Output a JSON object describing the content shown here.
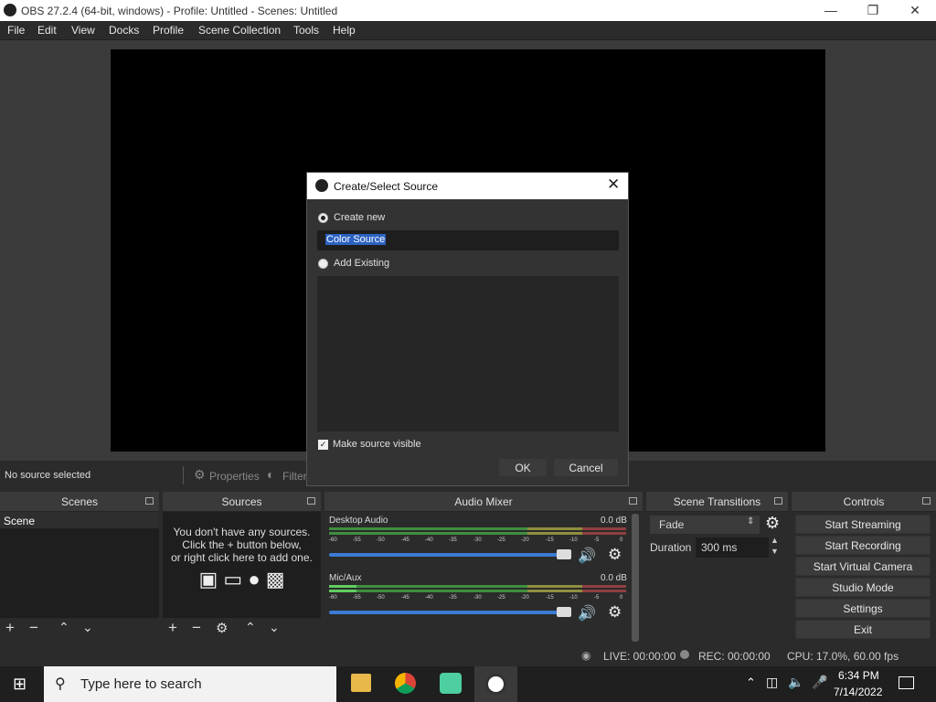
{
  "window": {
    "title": "OBS 27.2.4 (64-bit, windows) - Profile: Untitled - Scenes: Untitled"
  },
  "menu": [
    "File",
    "Edit",
    "View",
    "Docks",
    "Profile",
    "Scene Collection",
    "Tools",
    "Help"
  ],
  "props_bar": {
    "no_source": "No source selected",
    "properties": "Properties",
    "filters": "Filter"
  },
  "dialog": {
    "title": "Create/Select Source",
    "create_new": "Create new",
    "name_value": "Color Source",
    "add_existing": "Add Existing",
    "make_visible": "Make source visible",
    "ok": "OK",
    "cancel": "Cancel"
  },
  "scenes": {
    "header": "Scenes",
    "items": [
      "Scene"
    ]
  },
  "sources": {
    "header": "Sources",
    "empty_msg_1": "You don't have any sources.",
    "empty_msg_2": "Click the + button below,",
    "empty_msg_3": "or right click here to add one."
  },
  "mixer": {
    "header": "Audio Mixer",
    "channels": [
      {
        "name": "Desktop Audio",
        "db": "0.0 dB"
      },
      {
        "name": "Mic/Aux",
        "db": "0.0 dB"
      }
    ],
    "tick_labels": [
      "-60",
      "-55",
      "-50",
      "-45",
      "-40",
      "-35",
      "-30",
      "-25",
      "-20",
      "-15",
      "-10",
      "-5",
      "0"
    ]
  },
  "transitions": {
    "header": "Scene Transitions",
    "selected": "Fade",
    "duration_label": "Duration",
    "duration_value": "300 ms"
  },
  "controls": {
    "header": "Controls",
    "buttons": [
      "Start Streaming",
      "Start Recording",
      "Start Virtual Camera",
      "Studio Mode",
      "Settings",
      "Exit"
    ]
  },
  "status": {
    "live": "LIVE: 00:00:00",
    "rec": "REC: 00:00:00",
    "cpu": "CPU: 17.0%, 60.00 fps"
  },
  "taskbar": {
    "search_placeholder": "Type here to search",
    "time": "6:34 PM",
    "date": "7/14/2022"
  },
  "colors": {
    "accent": "#3b7bd4",
    "meter_green": "#3f8f3f",
    "meter_yellow": "#8f8f3f",
    "meter_red": "#8f3f3f"
  }
}
